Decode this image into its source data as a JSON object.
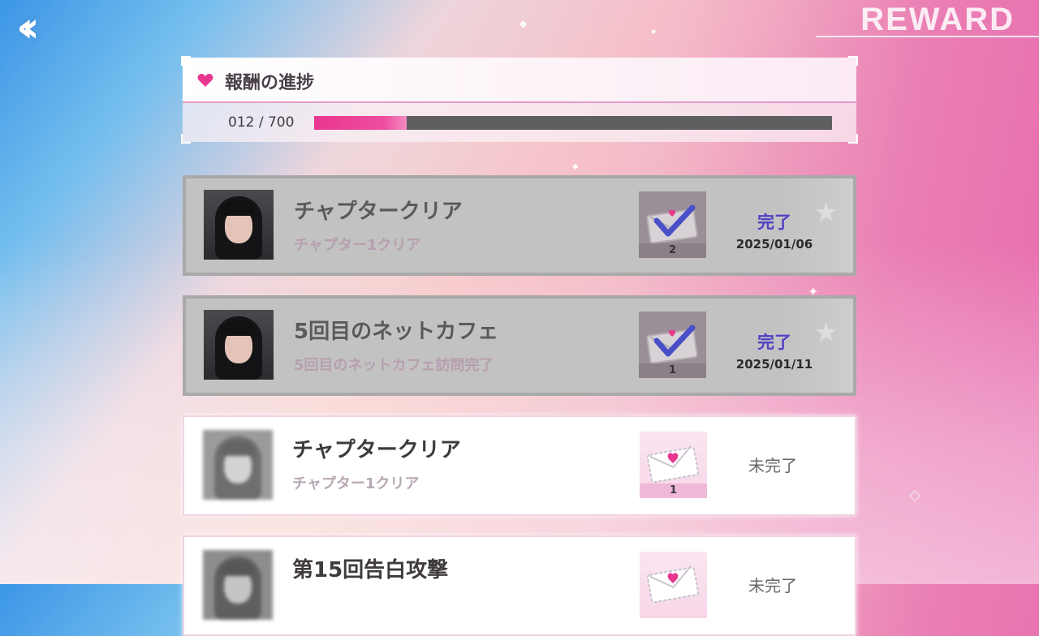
{
  "header": {
    "back_icon": "double-chevron-left-icon",
    "title": "REWARD"
  },
  "progress": {
    "title": "報酬の進捗",
    "current": 12,
    "total": 700,
    "display": "012 / 700",
    "fill_fraction": 0.178,
    "heart_color": "#e8378f"
  },
  "rewards": [
    {
      "title": "チャプタークリア",
      "desc": "チャプター1クリア",
      "quantity": "2",
      "status": "完了",
      "date": "2025/01/06",
      "completed": true,
      "avatar_icon": "character-portrait",
      "reward_icon": "checked-letter-icon"
    },
    {
      "title": "5回目のネットカフェ",
      "desc": "5回目のネットカフェ訪問完了",
      "quantity": "1",
      "status": "完了",
      "date": "2025/01/11",
      "completed": true,
      "avatar_icon": "character-portrait",
      "reward_icon": "checked-letter-icon"
    },
    {
      "title": "チャプタークリア",
      "desc": "チャプター1クリア",
      "quantity": "1",
      "status": "未完了",
      "date": "",
      "completed": false,
      "avatar_icon": "character-portrait-locked",
      "reward_icon": "love-letter-icon"
    },
    {
      "title": "第15回告白攻撃",
      "desc": "",
      "quantity": "",
      "status": "未完了",
      "date": "",
      "completed": false,
      "avatar_icon": "character-portrait-locked",
      "reward_icon": "love-letter-icon"
    }
  ],
  "colors": {
    "accent_pink": "#e8378f",
    "completed_text": "#4d3fc4",
    "bar_track": "#5f5f62"
  }
}
